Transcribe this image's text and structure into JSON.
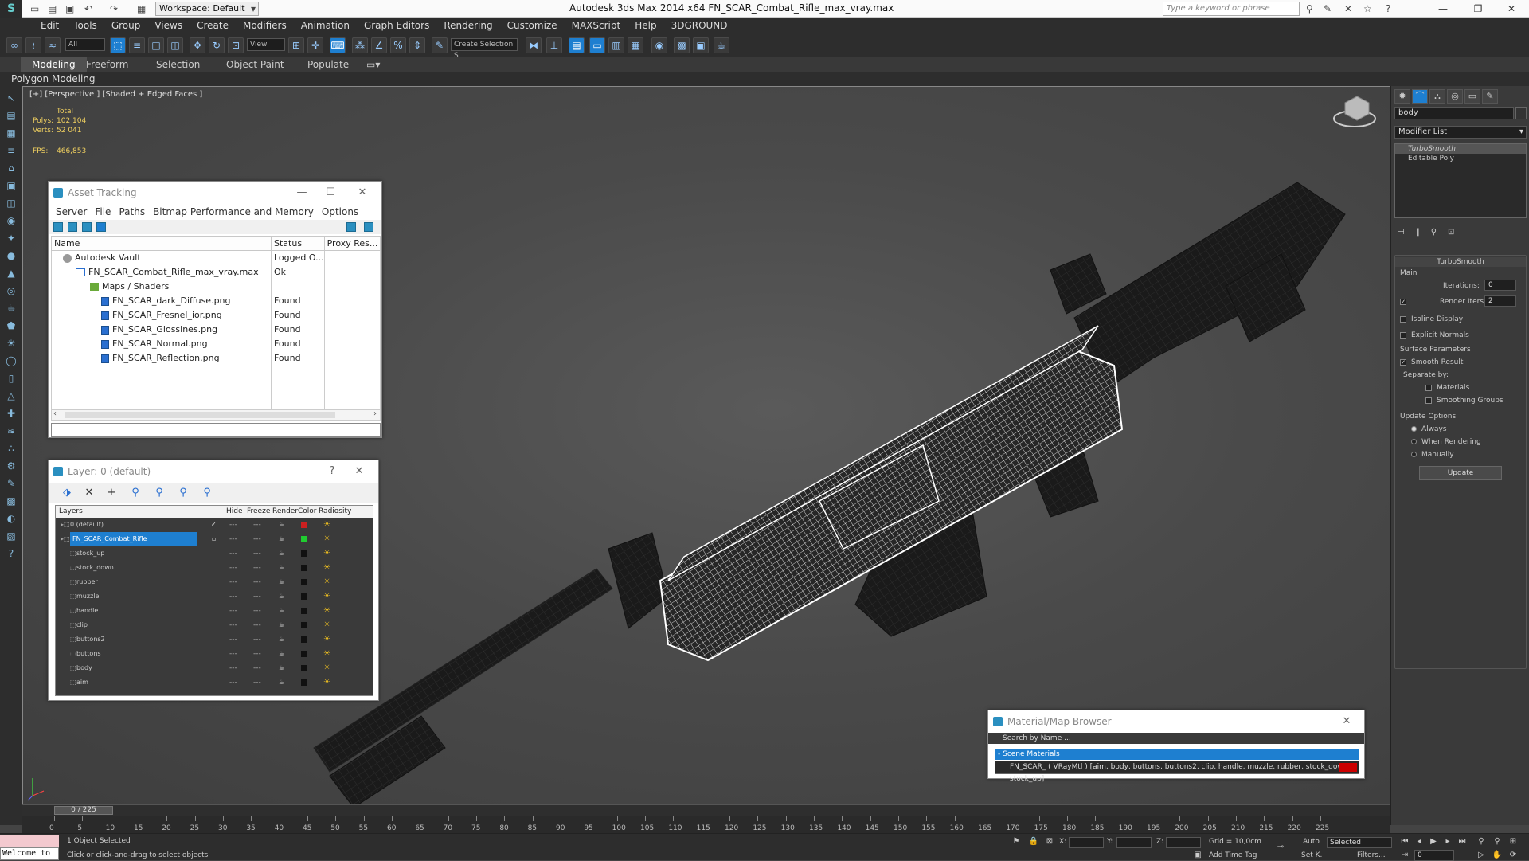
{
  "titlebar": {
    "workspace": "Workspace: Default",
    "title": "Autodesk 3ds Max  2014 x64     FN_SCAR_Combat_Rifle_max_vray.max",
    "search_placeholder": "Type a keyword or phrase"
  },
  "menu": [
    "Edit",
    "Tools",
    "Group",
    "Views",
    "Create",
    "Modifiers",
    "Animation",
    "Graph Editors",
    "Rendering",
    "Customize",
    "MAXScript",
    "Help",
    "3DGROUND"
  ],
  "toolbar": {
    "filter": "All",
    "refcoord": "View",
    "named_selection": "Create Selection S"
  },
  "ribbon": {
    "tabs": [
      "Modeling",
      "Freeform",
      "Selection",
      "Object Paint",
      "Populate"
    ],
    "active_tab": "Modeling",
    "sub_label": "Polygon Modeling"
  },
  "viewport": {
    "label": "[+] [Perspective ] [Shaded + Edged Faces ]",
    "stats_total_label": "Total",
    "polys_label": "Polys:",
    "polys": "102 104",
    "verts_label": "Verts:",
    "verts": "52 041",
    "fps_label": "FPS:",
    "fps": "466,853"
  },
  "asset_tracking": {
    "title": "Asset Tracking",
    "menu": [
      "Server",
      "File",
      "Paths",
      "Bitmap Performance and Memory",
      "Options"
    ],
    "columns": [
      "Name",
      "Status",
      "Proxy Res..."
    ],
    "rows": [
      {
        "name": "Autodesk Vault",
        "status": "Logged O...",
        "icon": "vault"
      },
      {
        "name": "FN_SCAR_Combat_Rifle_max_vray.max",
        "status": "Ok",
        "icon": "max-file"
      },
      {
        "name": "Maps / Shaders",
        "status": "",
        "icon": "folder"
      },
      {
        "name": "FN_SCAR_dark_Diffuse.png",
        "status": "Found",
        "icon": "image-file"
      },
      {
        "name": "FN_SCAR_Fresnel_ior.png",
        "status": "Found",
        "icon": "image-file"
      },
      {
        "name": "FN_SCAR_Glossines.png",
        "status": "Found",
        "icon": "image-file"
      },
      {
        "name": "FN_SCAR_Normal.png",
        "status": "Found",
        "icon": "image-file"
      },
      {
        "name": "FN_SCAR_Reflection.png",
        "status": "Found",
        "icon": "image-file"
      }
    ]
  },
  "layer_explorer": {
    "title": "Layer: 0 (default)",
    "help": "?",
    "columns": [
      "Layers",
      "Hide",
      "Freeze",
      "Render",
      "Color",
      "Radiosity"
    ],
    "rows": [
      {
        "name": "0 (default)",
        "color": "#cc2020"
      },
      {
        "name": "FN_SCAR_Combat_Rifle",
        "color": "#20cc30"
      },
      {
        "name": "stock_up",
        "color": "#111111"
      },
      {
        "name": "stock_down",
        "color": "#111111"
      },
      {
        "name": "rubber",
        "color": "#111111"
      },
      {
        "name": "muzzle",
        "color": "#111111"
      },
      {
        "name": "handle",
        "color": "#111111"
      },
      {
        "name": "clip",
        "color": "#111111"
      },
      {
        "name": "buttons2",
        "color": "#111111"
      },
      {
        "name": "buttons",
        "color": "#111111"
      },
      {
        "name": "body",
        "color": "#111111"
      },
      {
        "name": "aim",
        "color": "#111111"
      }
    ],
    "selected_index": 1
  },
  "command_panel": {
    "object_name": "body",
    "modifier_list": "Modifier List",
    "stack": [
      "TurboSmooth",
      "Editable Poly"
    ],
    "rollout_title": "TurboSmooth",
    "main_label": "Main",
    "iterations_label": "Iterations:",
    "iterations": "0",
    "render_iters_label": "Render Iters:",
    "render_iters": "2",
    "isoline": "Isoline Display",
    "explicit_normals": "Explicit Normals",
    "surface_params": "Surface Parameters",
    "smooth_result": "Smooth Result",
    "separate_by": "Separate by:",
    "materials": "Materials",
    "smoothing_groups": "Smoothing Groups",
    "update_options": "Update Options",
    "always": "Always",
    "when_rendering": "When Rendering",
    "manually": "Manually",
    "update_btn": "Update"
  },
  "material_browser": {
    "title": "Material/Map Browser",
    "search": "Search by Name ...",
    "category": "- Scene Materials",
    "material": "FN_SCAR_  ( VRayMtl ) [aim, body, buttons, buttons2, clip, handle, muzzle, rubber, stock_down, stock_up]"
  },
  "timeline": {
    "slider": "0 / 225",
    "ticks": [
      "0",
      "5",
      "10",
      "15",
      "20",
      "25",
      "30",
      "35",
      "40",
      "45",
      "50",
      "55",
      "60",
      "65",
      "70",
      "75",
      "80",
      "85",
      "90",
      "95",
      "100",
      "105",
      "110",
      "115",
      "120",
      "125",
      "130",
      "135",
      "140",
      "145",
      "150",
      "155",
      "160",
      "165",
      "170",
      "175",
      "180",
      "185",
      "190",
      "195",
      "200",
      "205",
      "210",
      "215",
      "220",
      "225"
    ]
  },
  "status": {
    "maxscript": "Welcome to",
    "selected": "1 Object Selected",
    "prompt": "Click or click-and-drag to select objects",
    "x_label": "X:",
    "y_label": "Y:",
    "z_label": "Z:",
    "grid": "Grid = 10,0cm",
    "add_time_tag": "Add Time Tag",
    "auto": "Auto",
    "set_key": "Set K.",
    "selected_dropdown": "Selected",
    "filters": "Filters...",
    "frame": "0"
  }
}
